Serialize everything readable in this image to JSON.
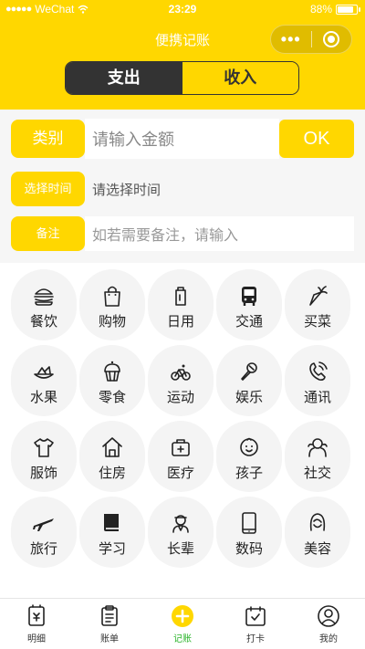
{
  "status_bar": {
    "signal": "●●●●●",
    "carrier": "WeChat",
    "time": "23:29",
    "battery": "88%",
    "battery_level": 0.88
  },
  "nav": {
    "title": "便携记账"
  },
  "type_toggle": {
    "expense": "支出",
    "income": "收入",
    "selected": "expense"
  },
  "form": {
    "category_label": "类别",
    "amount_placeholder": "请输入金额",
    "ok_label": "OK",
    "time_label": "选择时间",
    "time_placeholder": "请选择时间",
    "note_label": "备注",
    "note_placeholder": "如若需要备注，请输入"
  },
  "categories": [
    {
      "label": "餐饮",
      "icon": "burger-icon"
    },
    {
      "label": "购物",
      "icon": "shopping-bag-icon"
    },
    {
      "label": "日用",
      "icon": "daily-use-icon"
    },
    {
      "label": "交通",
      "icon": "bus-icon"
    },
    {
      "label": "买菜",
      "icon": "carrot-icon"
    },
    {
      "label": "水果",
      "icon": "fruit-icon"
    },
    {
      "label": "零食",
      "icon": "cupcake-icon"
    },
    {
      "label": "运动",
      "icon": "bicycle-icon"
    },
    {
      "label": "娱乐",
      "icon": "microphone-icon"
    },
    {
      "label": "通讯",
      "icon": "phone-icon"
    },
    {
      "label": "服饰",
      "icon": "tshirt-icon"
    },
    {
      "label": "住房",
      "icon": "house-icon"
    },
    {
      "label": "医疗",
      "icon": "medical-kit-icon"
    },
    {
      "label": "孩子",
      "icon": "baby-icon"
    },
    {
      "label": "社交",
      "icon": "social-icon"
    },
    {
      "label": "旅行",
      "icon": "airplane-icon"
    },
    {
      "label": "学习",
      "icon": "book-icon"
    },
    {
      "label": "长辈",
      "icon": "elder-icon"
    },
    {
      "label": "数码",
      "icon": "smartphone-icon"
    },
    {
      "label": "美容",
      "icon": "beauty-icon"
    }
  ],
  "tabs": [
    {
      "label": "明细",
      "icon": "detail-icon",
      "active": false
    },
    {
      "label": "账单",
      "icon": "bill-icon",
      "active": false
    },
    {
      "label": "记账",
      "icon": "add-icon",
      "active": true
    },
    {
      "label": "打卡",
      "icon": "calendar-icon",
      "active": false
    },
    {
      "label": "我的",
      "icon": "user-icon",
      "active": false
    }
  ],
  "colors": {
    "accent": "#ffd700",
    "dark": "#333333",
    "active_tab": "#2db52d"
  }
}
